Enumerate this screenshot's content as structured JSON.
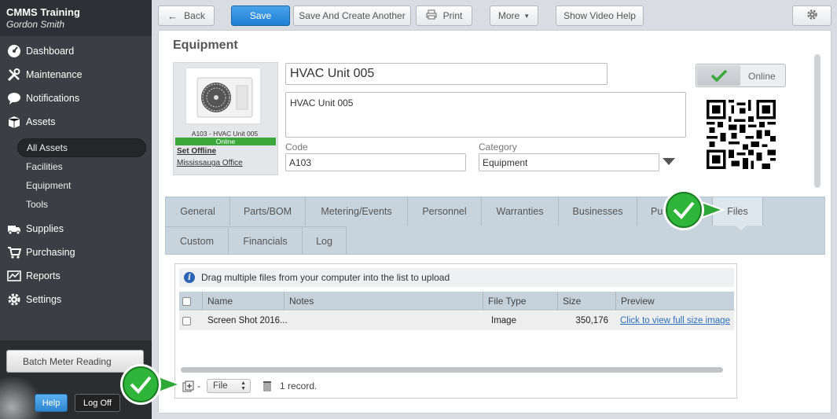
{
  "sidebar": {
    "title": "CMMS Training",
    "user": "Gordon Smith",
    "items": [
      {
        "label": "Dashboard",
        "icon": "dashboard-gauge-icon"
      },
      {
        "label": "Maintenance",
        "icon": "tools-icon"
      },
      {
        "label": "Notifications",
        "icon": "speech-bubble-icon"
      },
      {
        "label": "Assets",
        "icon": "box-icon"
      }
    ],
    "sub_items": [
      "All Assets",
      "Facilities",
      "Equipment",
      "Tools"
    ],
    "items2": [
      {
        "label": "Supplies",
        "icon": "truck-icon"
      },
      {
        "label": "Purchasing",
        "icon": "cart-icon"
      },
      {
        "label": "Reports",
        "icon": "chart-icon"
      },
      {
        "label": "Settings",
        "icon": "gear-icon"
      }
    ],
    "batch_label": "Batch Meter Reading",
    "help_label": "Help",
    "logoff_label": "Log Off"
  },
  "toolbar": {
    "back_label": "Back",
    "save_label": "Save",
    "save_another_label": "Save And Create Another",
    "print_label": "Print",
    "more_label": "More",
    "video_label": "Show Video Help"
  },
  "main": {
    "title": "Equipment",
    "image_caption": "A103 - HVAC Unit 005",
    "status_bar": "Online",
    "set_offline": "Set Offline",
    "location": "Mississauga Office",
    "name_value": "HVAC Unit 005",
    "description_value": "HVAC Unit 005",
    "code_label": "Code",
    "code_value": "A103",
    "category_label": "Category",
    "category_value": "Equipment",
    "toggle_label": "Online"
  },
  "tabs": {
    "row1": [
      "General",
      "Parts/BOM",
      "Metering/Events",
      "Personnel",
      "Warranties",
      "Businesses",
      "Pu",
      "Files"
    ],
    "row2": [
      "Custom",
      "Financials",
      "Log"
    ]
  },
  "files": {
    "info": "Drag multiple files from your computer into the list to upload",
    "columns": [
      "Name",
      "Notes",
      "File Type",
      "Size",
      "Preview"
    ],
    "rows": [
      {
        "name": "Screen Shot 2016...",
        "notes": "",
        "type": "Image",
        "size": "350,176",
        "preview": "Click to view full size image"
      }
    ],
    "file_select": "File",
    "record_count": "1 record."
  },
  "colors": {
    "primary_blue": "#1f7fd3",
    "online_green": "#3aa83a",
    "sidebar_bg": "#3b3e42",
    "tab_bg": "#c7d4de"
  }
}
